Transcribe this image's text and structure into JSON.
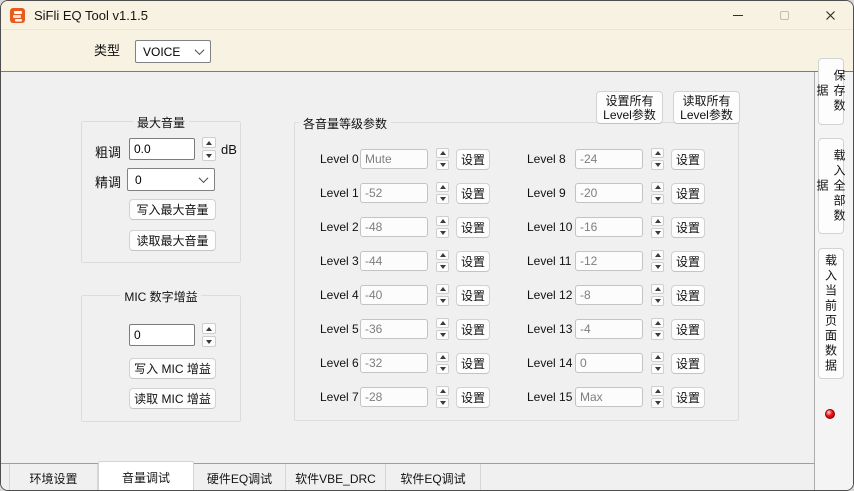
{
  "window": {
    "title": "SiFli EQ Tool v1.1.5"
  },
  "topbar": {
    "type_label": "类型",
    "type_value": "VOICE"
  },
  "max_volume": {
    "title": "最大音量",
    "coarse_label": "粗调",
    "coarse_value": "0.0",
    "unit": "dB",
    "fine_label": "精调",
    "fine_value": "0",
    "write_button": "写入最大音量",
    "read_button": "读取最大音量"
  },
  "mic_gain": {
    "title": "MIC 数字增益",
    "value": "0",
    "write_button": "写入 MIC 增益",
    "read_button": "读取 MIC 增益"
  },
  "levels": {
    "title": "各音量等级参数",
    "set_all_line1": "设置所有",
    "set_all_line2": "Level参数",
    "read_all_line1": "读取所有",
    "read_all_line2": "Level参数",
    "set_button": "设置",
    "rows": [
      {
        "label": "Level 0",
        "value": "Mute"
      },
      {
        "label": "Level 1",
        "value": "-52"
      },
      {
        "label": "Level 2",
        "value": "-48"
      },
      {
        "label": "Level 3",
        "value": "-44"
      },
      {
        "label": "Level 4",
        "value": "-40"
      },
      {
        "label": "Level 5",
        "value": "-36"
      },
      {
        "label": "Level 6",
        "value": "-32"
      },
      {
        "label": "Level 7",
        "value": "-28"
      },
      {
        "label": "Level 8",
        "value": "-24"
      },
      {
        "label": "Level 9",
        "value": "-20"
      },
      {
        "label": "Level 10",
        "value": "-16"
      },
      {
        "label": "Level 11",
        "value": "-12"
      },
      {
        "label": "Level 12",
        "value": "-8"
      },
      {
        "label": "Level 13",
        "value": "-4"
      },
      {
        "label": "Level 14",
        "value": "0"
      },
      {
        "label": "Level 15",
        "value": "Max"
      }
    ]
  },
  "sidebar": {
    "led_color": "#ee1414",
    "buttons": [
      {
        "name": "save-data-button",
        "label": "保存数据"
      },
      {
        "name": "load-all-data-button",
        "label": "载入全部数据"
      },
      {
        "name": "load-current-page-data-button",
        "label": "载入当前页面数据"
      }
    ]
  },
  "tabs": [
    {
      "name": "tab-env-settings",
      "label": "环境设置",
      "active": false
    },
    {
      "name": "tab-volume-debug",
      "label": "音量调试",
      "active": true
    },
    {
      "name": "tab-hw-eq-debug",
      "label": "硬件EQ调试",
      "active": false
    },
    {
      "name": "tab-sw-vbe-drc",
      "label": "软件VBE_DRC",
      "active": false
    },
    {
      "name": "tab-sw-eq-debug",
      "label": "软件EQ调试",
      "active": false
    }
  ]
}
